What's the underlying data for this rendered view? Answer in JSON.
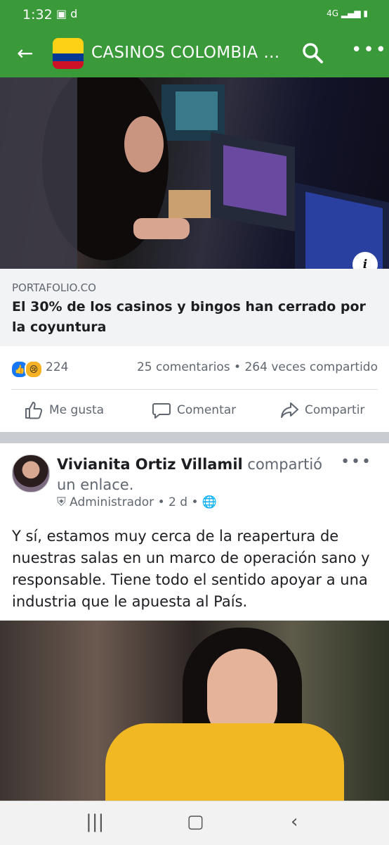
{
  "status_bar": {
    "time": "1:32",
    "network": "4G"
  },
  "top_bar": {
    "title": "CASINOS COLOMBIA O..."
  },
  "link_preview": {
    "source": "PORTAFOLIO.CO",
    "headline": "El 30% de los casinos y bingos han cerrado por la coyuntura"
  },
  "engagement": {
    "reaction_count": "224",
    "comments": "25 comentarios",
    "shares": "264 veces compartido",
    "separator": "•"
  },
  "actions": {
    "like": "Me gusta",
    "comment": "Comentar",
    "share": "Compartir"
  },
  "post": {
    "author": "Vivianita Ortiz Villamil",
    "shared_text": "compartió un enlace.",
    "role": "Administrador",
    "age": "2 d",
    "body": "Y sí, estamos muy cerca de la reapertura de nuestras salas en un marco de operación sano y responsable. Tiene todo el sentido apoyar a una industria que le apuesta al País."
  },
  "colors": {
    "app_bar": "#3a9a3a",
    "like_blue": "#1877f2",
    "secondary_text": "#606770",
    "link_bg": "#f2f3f5"
  },
  "icons": [
    "back-arrow-icon",
    "search-icon",
    "more-icon",
    "info-icon",
    "like-icon",
    "comment-icon",
    "share-icon",
    "globe-icon",
    "shield-icon",
    "recents-icon",
    "home-icon",
    "back-nav-icon"
  ]
}
